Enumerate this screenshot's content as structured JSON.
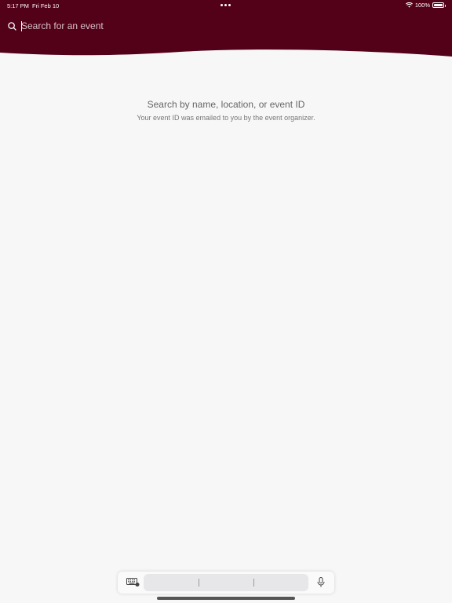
{
  "status_bar": {
    "time": "5:17 PM",
    "date": "Fri Feb 10",
    "battery": "100%"
  },
  "search": {
    "placeholder": "Search for an event",
    "value": ""
  },
  "empty_state": {
    "title": "Search by name, location, or event ID",
    "subtitle": "Your event ID was emailed to you by the event organizer."
  },
  "icons": {
    "search": "search-icon",
    "wifi": "wifi-icon",
    "battery": "battery-icon",
    "keyboard": "keyboard-icon",
    "mic": "microphone-icon"
  },
  "colors": {
    "header": "#530019",
    "background": "#f7f7f7"
  }
}
